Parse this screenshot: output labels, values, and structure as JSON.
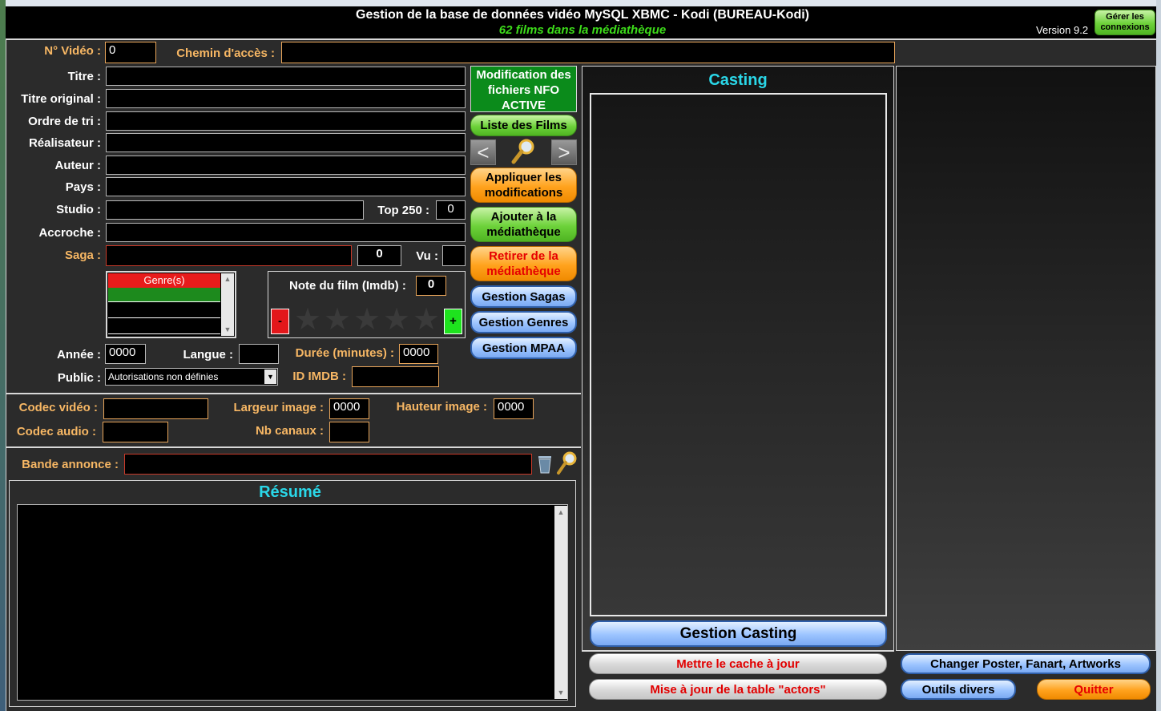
{
  "header": {
    "title": "Gestion de la base de données vidéo MySQL XBMC - Kodi (BUREAU-Kodi)",
    "subtitle": "62 films dans la médiathèque",
    "version": "Version 9.2",
    "connections_button": "Gérer les connexions"
  },
  "form": {
    "video_no_label": "N° Vidéo :",
    "video_no_value": "0",
    "path_label": "Chemin d'accès :",
    "path_value": "",
    "title_label": "Titre :",
    "original_title_label": "Titre original :",
    "sort_label": "Ordre de tri :",
    "director_label": "Réalisateur :",
    "author_label": "Auteur :",
    "country_label": "Pays :",
    "studio_label": "Studio :",
    "top250_label": "Top 250 :",
    "top250_value": "0",
    "tagline_label": "Accroche :",
    "saga_label": "Saga :",
    "saga_value": "0",
    "seen_label": "Vu :",
    "genres_header": "Genre(s)",
    "rating_label": "Note du film (Imdb) :",
    "rating_value": "0",
    "minus": "-",
    "plus": "+",
    "year_label": "Année :",
    "year_value": "0000",
    "language_label": "Langue :",
    "duration_label": "Durée (minutes) :",
    "duration_value": "0000",
    "public_label": "Public :",
    "public_value": "Autorisations non définies",
    "imdb_label": "ID IMDB :"
  },
  "tech": {
    "video_codec_label": "Codec vidéo :",
    "width_label": "Largeur image :",
    "width_value": "0000",
    "height_label": "Hauteur image :",
    "height_value": "0000",
    "audio_codec_label": "Codec audio :",
    "channels_label": "Nb canaux :"
  },
  "trailer": {
    "label": "Bande annonce :"
  },
  "summary": {
    "title": "Résumé"
  },
  "actions": {
    "nfo_status": "Modification des fichiers NFO ACTIVE",
    "film_list": "Liste des Films",
    "apply": "Appliquer les modifications",
    "add": "Ajouter à la médiathèque",
    "remove": "Retirer de la médiathèque",
    "sagas": "Gestion Sagas",
    "genres": "Gestion Genres",
    "mpaa": "Gestion MPAA"
  },
  "casting": {
    "title": "Casting",
    "manage": "Gestion Casting",
    "update_cache": "Mettre le cache à jour",
    "update_actors": "Mise à jour de la table \"actors\""
  },
  "right": {
    "artworks": "Changer Poster, Fanart, Artworks",
    "tools": "Outils divers",
    "quit": "Quitter"
  },
  "colors": {
    "accent_cyan": "#2ad7e8",
    "label_orange": "#f7b764",
    "subtitle_green": "#3ddc1a"
  }
}
